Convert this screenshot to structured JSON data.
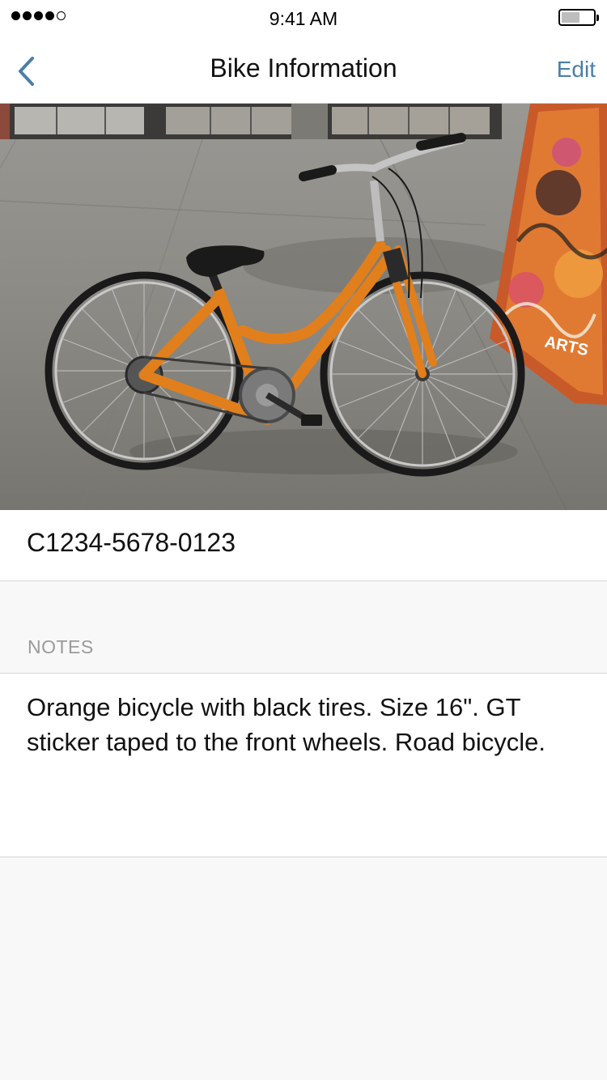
{
  "status_bar": {
    "time": "9:41 AM",
    "signal_bars_filled": 4,
    "signal_bars_total": 5,
    "battery_level": 0.5
  },
  "nav": {
    "title": "Bike Information",
    "edit_label": "Edit",
    "back_icon": "chevron-left-icon",
    "accent_color": "#4a7fa8"
  },
  "bike": {
    "photo_icon": "bike-photo",
    "id": "C1234-5678-0123"
  },
  "notes": {
    "header": "NOTES",
    "text": "Orange bicycle with black tires. Size 16\". GT sticker taped to the front wheels. Road bicycle."
  }
}
